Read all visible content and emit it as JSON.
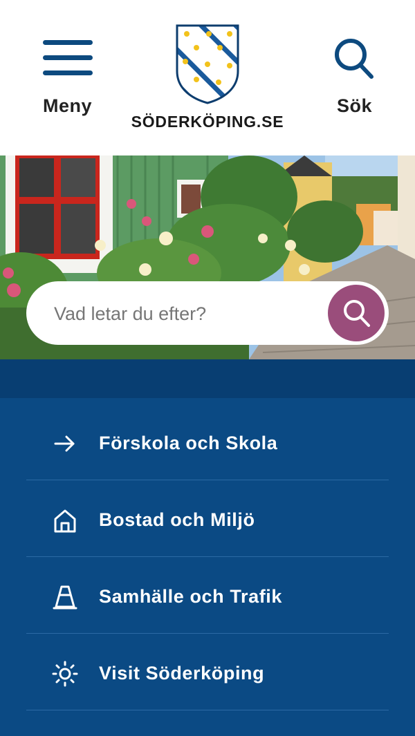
{
  "header": {
    "menu_label": "Meny",
    "search_label": "Sök",
    "site_name": "SÖDERKÖPING.SE",
    "logo_icon": "coat-of-arms-icon"
  },
  "hero": {
    "search_placeholder": "Vad letar du efter?"
  },
  "nav": {
    "items": [
      {
        "label": "Förskola och Skola",
        "icon": "arrow-right-icon"
      },
      {
        "label": "Bostad och Miljö",
        "icon": "house-icon"
      },
      {
        "label": "Samhälle och Trafik",
        "icon": "traffic-cone-icon"
      },
      {
        "label": "Visit Söderköping",
        "icon": "sun-icon"
      }
    ]
  },
  "colors": {
    "brand_blue": "#0b4a84",
    "search_accent": "#9a4d7b",
    "header_bg": "#ffffff"
  }
}
